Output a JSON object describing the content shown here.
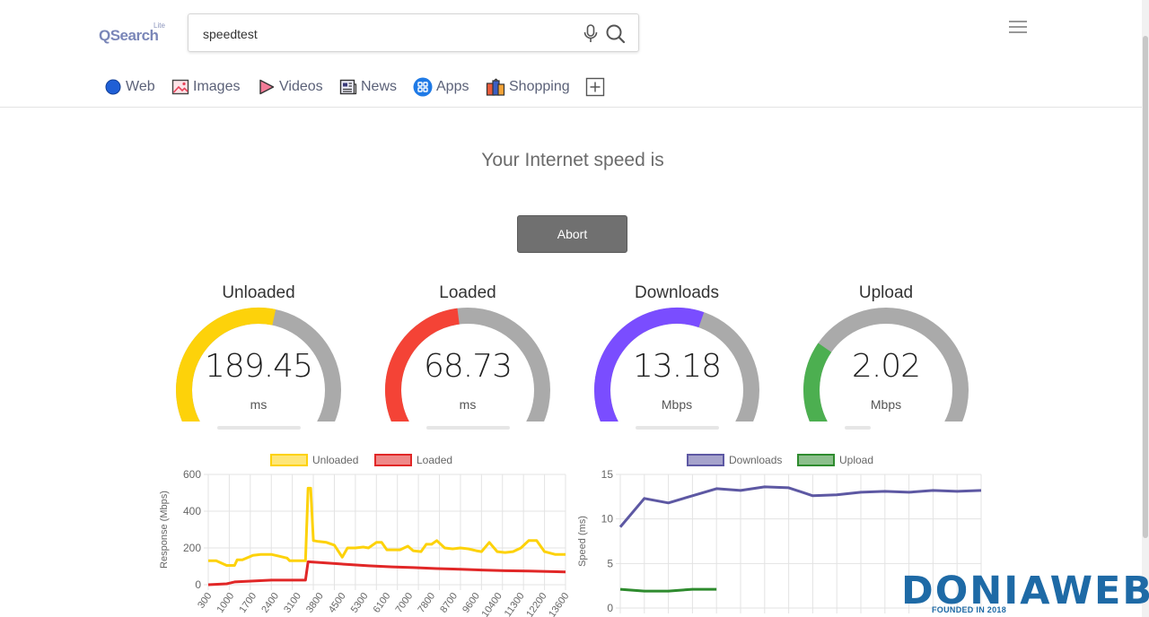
{
  "header": {
    "logo_text": "QSearch",
    "logo_superscript": "Lite",
    "search_value": "speedtest",
    "nav": [
      {
        "label": "Web",
        "icon": "web-icon"
      },
      {
        "label": "Images",
        "icon": "images-icon"
      },
      {
        "label": "Videos",
        "icon": "videos-icon"
      },
      {
        "label": "News",
        "icon": "news-icon"
      },
      {
        "label": "Apps",
        "icon": "apps-icon"
      },
      {
        "label": "Shopping",
        "icon": "shopping-icon"
      },
      {
        "label": "",
        "icon": "add-tab-icon"
      }
    ]
  },
  "main": {
    "headline": "Your Internet speed is",
    "abort_label": "Abort",
    "gauges": [
      {
        "title": "Unloaded",
        "value": "189.45",
        "unit": "ms",
        "fill": 0.55,
        "color": "#fdd20a",
        "bar": 0.62
      },
      {
        "title": "Loaded",
        "value": "68.73",
        "unit": "ms",
        "fill": 0.47,
        "color": "#f44336",
        "bar": 0.62
      },
      {
        "title": "Downloads",
        "value": "13.18",
        "unit": "Mbps",
        "fill": 0.58,
        "color": "#7a4dff",
        "bar": 0.62
      },
      {
        "title": "Upload",
        "value": "2.02",
        "unit": "Mbps",
        "fill": 0.27,
        "color": "#4caf50",
        "bar": 0.19
      }
    ]
  },
  "chart_data": [
    {
      "type": "line",
      "legend": [
        "Unloaded",
        "Loaded"
      ],
      "colors": [
        "#fdd20a",
        "#e12727"
      ],
      "ylabel": "Response (Mbps)",
      "ylim": [
        0,
        600
      ],
      "yticks": [
        0,
        200,
        400,
        600
      ],
      "xticks": [
        300,
        1000,
        1700,
        2400,
        3100,
        3800,
        4500,
        5300,
        6100,
        7000,
        7800,
        8700,
        9600,
        10400,
        11300,
        12200,
        13600
      ],
      "series": [
        {
          "name": "Unloaded",
          "x": [
            0,
            300,
            700,
            1000,
            1100,
            1300,
            1700,
            2000,
            2400,
            2700,
            3000,
            3100,
            3500,
            3700,
            3800,
            3900,
            4000,
            4200,
            4500,
            4800,
            5100,
            5300,
            5600,
            5900,
            6100,
            6400,
            6600,
            6800,
            7000,
            7300,
            7600,
            7800,
            8100,
            8300,
            8500,
            8700,
            9000,
            9300,
            9600,
            9900,
            10200,
            10400,
            10700,
            11000,
            11300,
            11600,
            11900,
            12200,
            12500,
            12800,
            13200,
            13600
          ],
          "values": [
            130,
            130,
            105,
            105,
            135,
            135,
            160,
            165,
            165,
            155,
            145,
            130,
            130,
            130,
            525,
            525,
            240,
            235,
            230,
            215,
            150,
            200,
            200,
            205,
            200,
            230,
            230,
            190,
            190,
            190,
            210,
            185,
            180,
            220,
            220,
            240,
            200,
            195,
            200,
            195,
            185,
            180,
            230,
            180,
            175,
            180,
            200,
            240,
            240,
            180,
            165,
            165
          ]
        },
        {
          "name": "Loaded",
          "x": [
            0,
            700,
            1000,
            1700,
            2400,
            3100,
            3500,
            3700,
            3800,
            4500,
            5300,
            6100,
            7000,
            7800,
            8700,
            9600,
            10400,
            11300,
            12200,
            13600
          ],
          "values": [
            0,
            5,
            15,
            20,
            25,
            25,
            25,
            25,
            125,
            118,
            110,
            103,
            97,
            93,
            88,
            84,
            80,
            76,
            74,
            70
          ]
        }
      ]
    },
    {
      "type": "line",
      "legend": [
        "Downloads",
        "Upload"
      ],
      "colors": [
        "#5d58a3",
        "#2e8b2e"
      ],
      "ylabel": "Speed (ms)",
      "ylim": [
        0,
        15
      ],
      "yticks": [
        0,
        5,
        10,
        15
      ],
      "series": [
        {
          "name": "Downloads",
          "values": [
            9.1,
            12.3,
            11.8,
            12.6,
            13.4,
            13.2,
            13.6,
            13.5,
            12.6,
            12.7,
            13.0,
            13.1,
            13.0,
            13.2,
            13.1,
            13.2
          ]
        },
        {
          "name": "Upload",
          "values": [
            2.1,
            1.9,
            1.9,
            2.1,
            2.1
          ]
        }
      ]
    }
  ],
  "watermark": {
    "text": "DONIAWEB",
    "sub": "FOUNDED IN 2018"
  }
}
